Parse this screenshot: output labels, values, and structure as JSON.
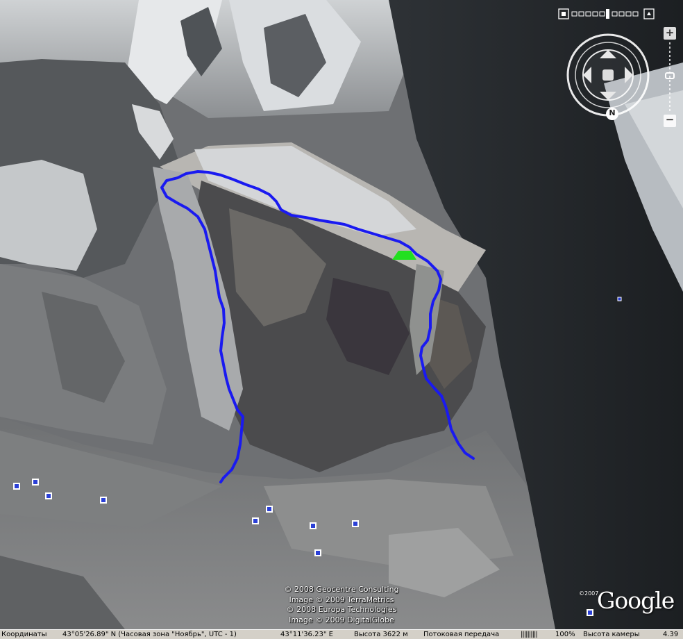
{
  "map": {
    "icons": {
      "look_ring": "look-joystick-icon",
      "move_ring": "move-joystick-icon",
      "north": "north-indicator-icon",
      "zoom_in": "plus-icon",
      "zoom_out": "minus-icon",
      "placemark": "square-placemark-icon",
      "base_camp": "green-tent-placemark-icon"
    },
    "colors": {
      "route": "#1a1af0",
      "base_camp": "#22e020",
      "placemark": "#2a3fd6"
    },
    "placemark_count": 11
  },
  "controls": {
    "north_label": "N",
    "zoom_in_label": "+",
    "zoom_out_label": "−"
  },
  "attribution": {
    "line1": "© 2008 Geocentre Consulting",
    "line2": "Image © 2009 TerraMetrics",
    "line3": "© 2008 Europa Technologies",
    "line4": "Image © 2009 DigitalGlobe"
  },
  "logo": {
    "year": "©2007",
    "text": "Google"
  },
  "status": {
    "coords_label": "Координаты",
    "lat": "43°05'26.89\" N (Часовая зона \"Ноябрь\", UTC - 1)",
    "lon": "43°11'36.23\" E",
    "elevation": "Высота 3622 м",
    "streaming_label": "Потоковая передача",
    "streaming_bar": "||||||||||",
    "streaming_percent": "100%",
    "camera_label": "Высота камеры",
    "camera_value": "4.39"
  }
}
